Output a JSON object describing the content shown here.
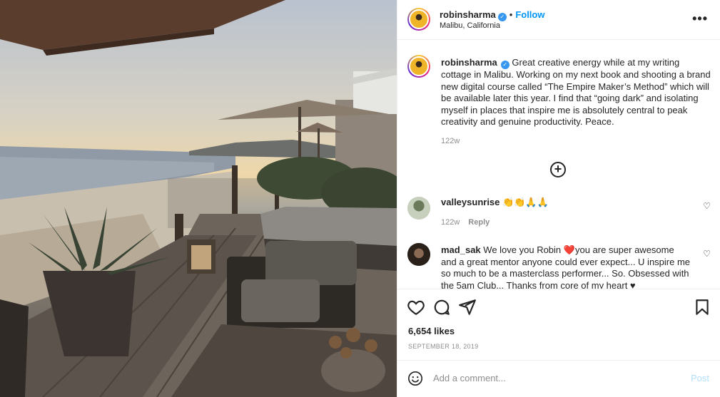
{
  "post": {
    "username": "robinsharma",
    "follow_label": "Follow",
    "location": "Malibu, California",
    "more_icon": "more-horizontal-icon"
  },
  "caption": {
    "username": "robinsharma",
    "text": "Great creative energy while at my writing cottage in Malibu. Working on my next book and shooting a brand new digital course called “The Empire Maker’s Method” which will be available later this year. I find that “going dark” and isolating myself in places that inspire me is absolutely central to peak creativity and genuine productivity. Peace.",
    "time": "122w"
  },
  "load_more_icon": "plus-circle-icon",
  "comments": [
    {
      "username": "valleysunrise",
      "text": "👏👏🙏🙏",
      "time": "122w",
      "reply_label": "Reply"
    },
    {
      "username": "mad_sak",
      "text_before": "We love you Robin ",
      "heart": "❤️",
      "text_after": "you are super awesome and a great mentor anyone could ever expect... U inspire me so much to be a masterclass performer... So. Obsessed with the 5am Club... Thanks from core of my heart ♥"
    }
  ],
  "actions": {
    "like_icon": "heart-icon",
    "comment_icon": "comment-icon",
    "share_icon": "paper-plane-icon",
    "save_icon": "bookmark-icon"
  },
  "likes": "6,654 likes",
  "date": "SEPTEMBER 18, 2019",
  "add_comment": {
    "placeholder": "Add a comment...",
    "post_label": "Post"
  },
  "colors": {
    "accent": "#0095f6",
    "verified": "#3897f0",
    "post_disabled": "#b2dffc",
    "heart": "#ed4956"
  }
}
